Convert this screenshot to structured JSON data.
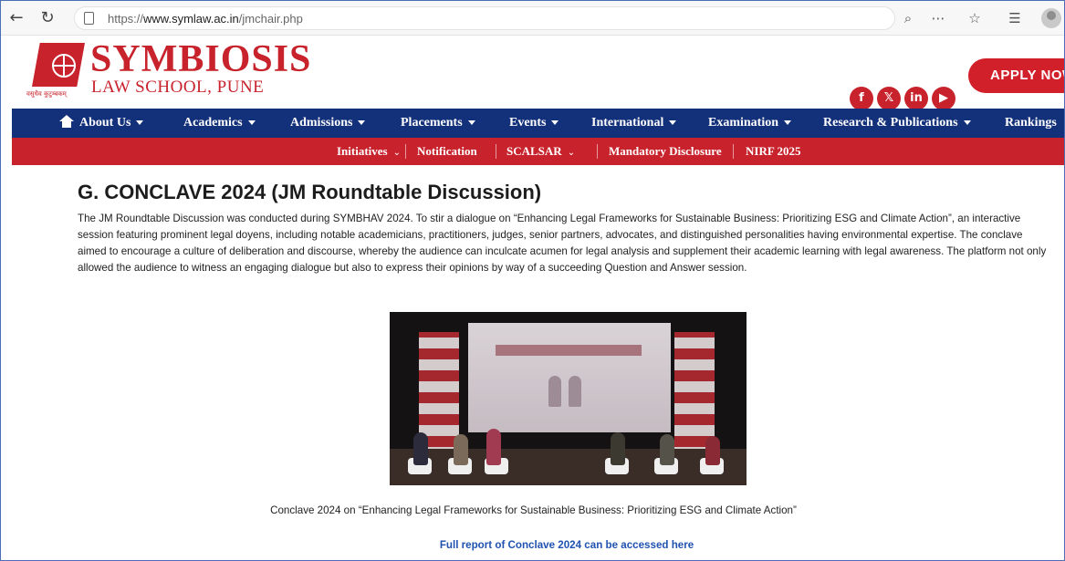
{
  "browser": {
    "back_glyph": "←",
    "reload_glyph": "↻",
    "url_prefix": "https://",
    "url_domain": "www.symlaw.ac.in",
    "url_path": "/jmchair.php",
    "zoom_glyph": "⌕",
    "more_glyph": "⋯",
    "favorite_glyph": "☆",
    "collections_glyph": "☰"
  },
  "header": {
    "brand_name": "SYMBIOSIS",
    "brand_sub": "LAW SCHOOL, PUNE",
    "logo_tagline": "वसुधैव कुटुम्बकम्",
    "social": [
      {
        "icon": "facebook-icon",
        "glyph": "f"
      },
      {
        "icon": "x-icon",
        "glyph": "𝕏"
      },
      {
        "icon": "linkedin-icon",
        "glyph": "in"
      },
      {
        "icon": "youtube-icon",
        "glyph": "▶"
      }
    ],
    "apply_label": "APPLY NOW",
    "brand_color": "#c8232c"
  },
  "main_nav": {
    "color": "#13307a",
    "items": [
      {
        "label": "About Us"
      },
      {
        "label": "Academics"
      },
      {
        "label": "Admissions"
      },
      {
        "label": "Placements"
      },
      {
        "label": "Events"
      },
      {
        "label": "International"
      },
      {
        "label": "Examination"
      },
      {
        "label": "Research & Publications"
      },
      {
        "label": "Rankings"
      }
    ]
  },
  "sub_nav": {
    "items": [
      {
        "label": "Initiatives"
      },
      {
        "label": "Notification"
      },
      {
        "label": "SCALSAR"
      },
      {
        "label": "Mandatory Disclosure"
      },
      {
        "label": "NIRF 2025"
      }
    ]
  },
  "content": {
    "title": "G. CONCLAVE 2024 (JM Roundtable Discussion)",
    "intro": "The JM Roundtable Discussion was conducted during SYMBHAV 2024. To stir a dialogue on “Enhancing Legal Frameworks for Sustainable Business: Prioritizing ESG and Climate Action”, an interactive session featuring prominent legal doyens, including notable academicians, practitioners, judges, senior partners, advocates, and distinguished personalities having environmental expertise. The conclave aimed to encourage a culture of deliberation and discourse, whereby the audience can inculcate acumen for legal analysis and supplement their academic learning with legal awareness. The platform not only allowed the audience to witness an engaging dialogue but also to express their opinions by way of a succeeding Question and Answer session.",
    "caption": "Conclave 2024 on “Enhancing Legal Frameworks for Sustainable Business: Prioritizing ESG and Climate Action”",
    "report_link": "Full report of Conclave 2024 can be accessed here",
    "link_color": "#2052b0"
  }
}
